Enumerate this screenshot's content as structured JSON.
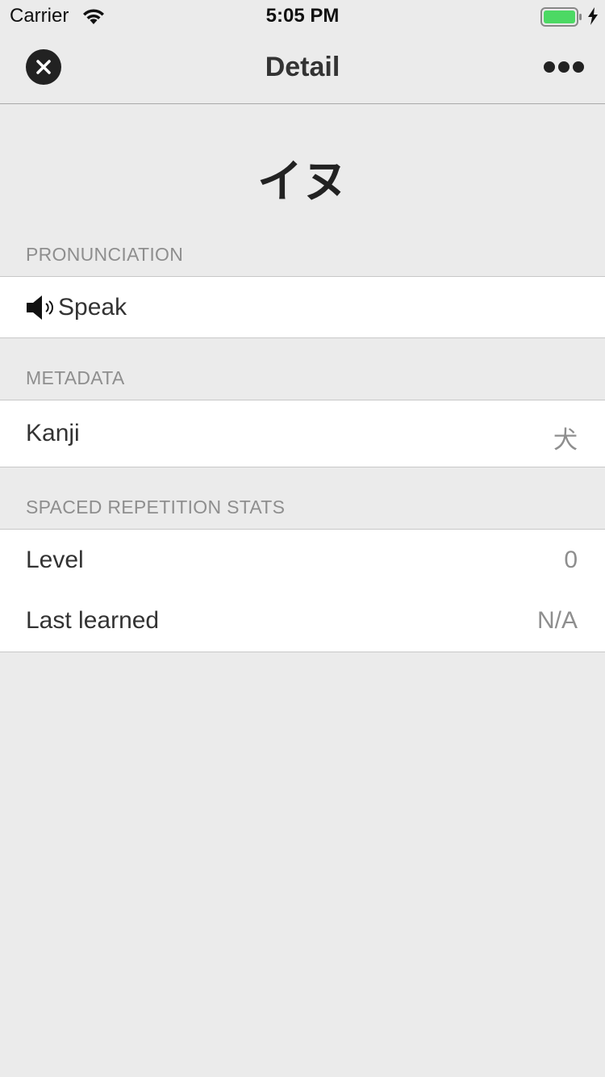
{
  "status_bar": {
    "carrier": "Carrier",
    "time": "5:05 PM",
    "battery_level": 1.0,
    "battery_color": "#4cd964",
    "wifi_icon": "wifi-icon",
    "charging_icon": "bolt-icon"
  },
  "nav": {
    "title": "Detail",
    "close_icon": "close-icon",
    "more_icon": "more-icon"
  },
  "headword": "イヌ",
  "sections": {
    "pronunciation": {
      "header": "PRONUNCIATION",
      "speak_label": "Speak",
      "speaker_icon": "speaker-icon"
    },
    "metadata": {
      "header": "METADATA",
      "kanji_label": "Kanji",
      "kanji_value": "犬"
    },
    "stats": {
      "header": "SPACED REPETITION STATS",
      "level_label": "Level",
      "level_value": "0",
      "last_learned_label": "Last learned",
      "last_learned_value": "N/A"
    }
  }
}
